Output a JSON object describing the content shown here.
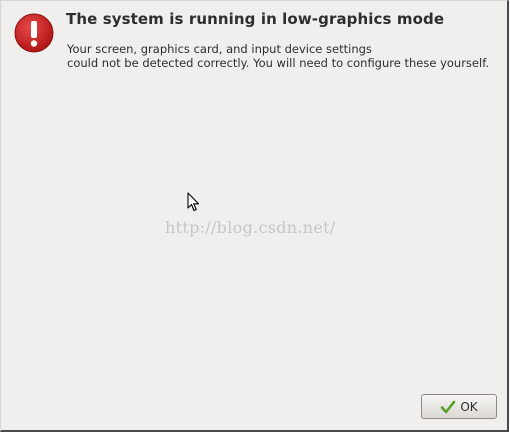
{
  "dialog": {
    "icon": "error-exclamation-icon",
    "title": "The system is running in low-graphics mode",
    "message_line1": "Your screen, graphics card, and input device settings",
    "message_line2": "could not be detected correctly.  You will need to configure these yourself.",
    "watermark": "http://blog.csdn.net/",
    "ok_button": {
      "label": "OK",
      "icon": "checkmark-icon"
    }
  },
  "colors": {
    "background": "#f0efed",
    "alert_red": "#cc1f1f",
    "checkmark_green": "#5a9e2a",
    "text": "#2e2e2e"
  }
}
